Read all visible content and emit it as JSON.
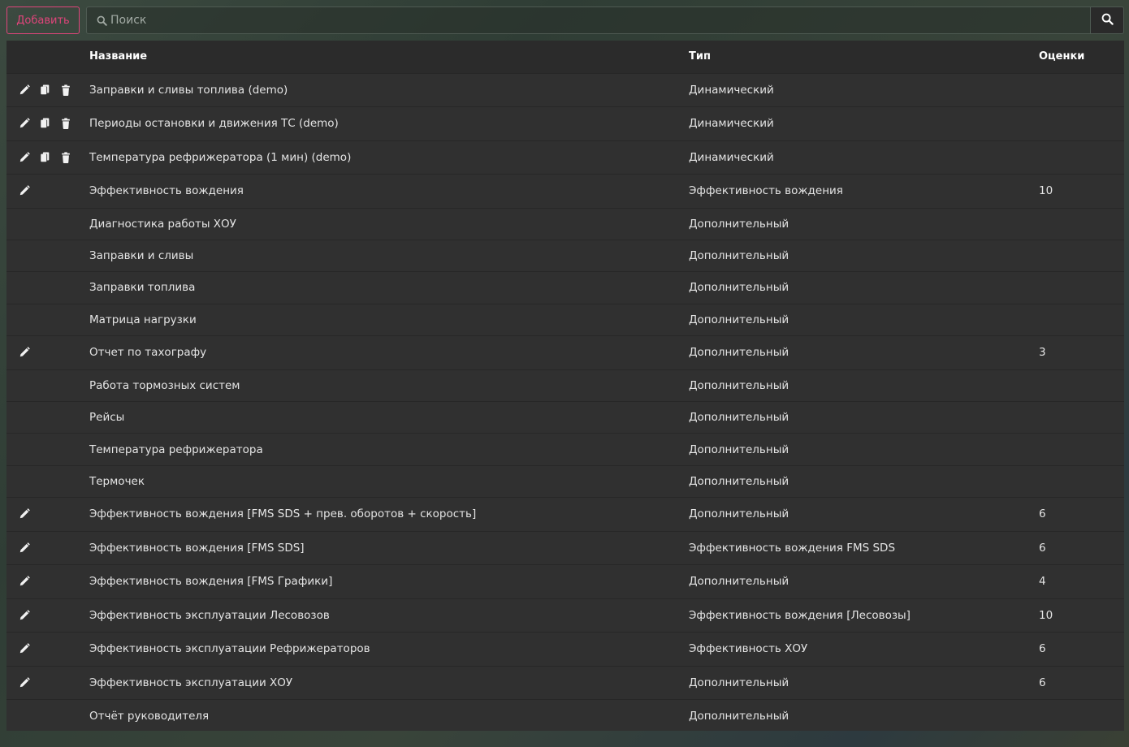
{
  "toolbar": {
    "add_label": "Добавить",
    "search_placeholder": "Поиск",
    "search_value": ""
  },
  "table": {
    "headers": {
      "name": "Название",
      "type": "Тип",
      "scores": "Оценки"
    },
    "rows": [
      {
        "name": "Заправки и сливы топлива (demo)",
        "type": "Динамический",
        "scores": "",
        "actions": [
          "edit",
          "copy",
          "delete"
        ]
      },
      {
        "name": "Периоды остановки и движения ТС (demo)",
        "type": "Динамический",
        "scores": "",
        "actions": [
          "edit",
          "copy",
          "delete"
        ]
      },
      {
        "name": "Температура рефрижератора (1 мин) (demo)",
        "type": "Динамический",
        "scores": "",
        "actions": [
          "edit",
          "copy",
          "delete"
        ]
      },
      {
        "name": "Эффективность вождения",
        "type": "Эффективность вождения",
        "scores": "10",
        "actions": [
          "edit"
        ]
      },
      {
        "name": "Диагностика работы ХОУ",
        "type": "Дополнительный",
        "scores": "",
        "actions": []
      },
      {
        "name": "Заправки и сливы",
        "type": "Дополнительный",
        "scores": "",
        "actions": []
      },
      {
        "name": "Заправки топлива",
        "type": "Дополнительный",
        "scores": "",
        "actions": []
      },
      {
        "name": "Матрица нагрузки",
        "type": "Дополнительный",
        "scores": "",
        "actions": []
      },
      {
        "name": "Отчет по тахографу",
        "type": "Дополнительный",
        "scores": "3",
        "actions": [
          "edit"
        ]
      },
      {
        "name": "Работа тормозных систем",
        "type": "Дополнительный",
        "scores": "",
        "actions": []
      },
      {
        "name": "Рейсы",
        "type": "Дополнительный",
        "scores": "",
        "actions": []
      },
      {
        "name": "Температура рефрижератора",
        "type": "Дополнительный",
        "scores": "",
        "actions": []
      },
      {
        "name": "Термочек",
        "type": "Дополнительный",
        "scores": "",
        "actions": []
      },
      {
        "name": "Эффективность вождения [FMS SDS + прев. оборотов + скорость]",
        "type": "Дополнительный",
        "scores": "6",
        "actions": [
          "edit"
        ]
      },
      {
        "name": "Эффективность вождения [FMS SDS]",
        "type": "Эффективность вождения FMS SDS",
        "scores": "6",
        "actions": [
          "edit"
        ]
      },
      {
        "name": "Эффективность вождения [FMS Графики]",
        "type": "Дополнительный",
        "scores": "4",
        "actions": [
          "edit"
        ]
      },
      {
        "name": "Эффективность эксплуатации Лесовозов",
        "type": "Эффективность вождения [Лесовозы]",
        "scores": "10",
        "actions": [
          "edit"
        ]
      },
      {
        "name": "Эффективность эксплуатации Рефрижераторов",
        "type": "Эффективность ХОУ",
        "scores": "6",
        "actions": [
          "edit"
        ]
      },
      {
        "name": "Эффективность эксплуатации ХОУ",
        "type": "Дополнительный",
        "scores": "6",
        "actions": [
          "edit"
        ]
      },
      {
        "name": "Отчёт руководителя",
        "type": "Дополнительный",
        "scores": "",
        "actions": []
      }
    ]
  },
  "icons": {
    "edit": "pencil-icon",
    "copy": "copy-icon",
    "delete": "trash-icon",
    "search": "search-icon"
  },
  "colors": {
    "accent": "#e0457b",
    "panel": "#303030",
    "header": "#2b2b2b"
  }
}
